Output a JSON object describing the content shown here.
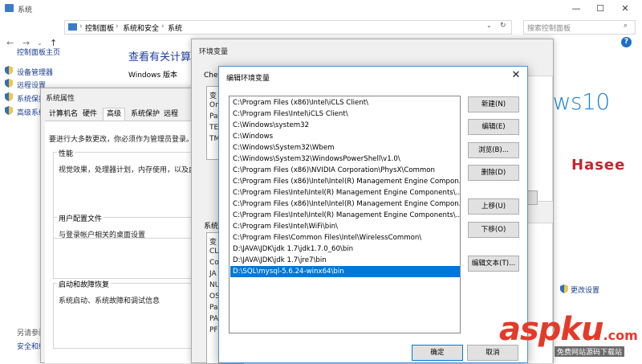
{
  "system_window": {
    "title": "系统",
    "breadcrumb": [
      "控制面板",
      "系统和安全",
      "系统"
    ],
    "search_placeholder": "搜索控制面板",
    "left_nav": {
      "home": "控制面板主页",
      "items": [
        "设备管理器",
        "远程设置",
        "系统保护",
        "高级系统"
      ],
      "see_also": "另请参阅",
      "security": "安全和维"
    },
    "heading": "查看有关计算机",
    "edition_label": "Windows 版本",
    "brand_text": "ows10",
    "logo_text": "Hasee",
    "change_settings": "更改设置",
    "help": "?"
  },
  "system_properties": {
    "title": "系统属性",
    "tabs": [
      "计算机名",
      "硬件",
      "高级",
      "系统保护",
      "远程"
    ],
    "active_tab": "高级",
    "admin_note": "要进行大多数更改，你必须作为管理员登录。",
    "groups": [
      {
        "title": "性能",
        "text": "视觉效果，处理器计划，内存使用，以及虚"
      },
      {
        "title": "用户配置文件",
        "text": "与登录帐户相关的桌面设置"
      },
      {
        "title": "启动和故障恢复",
        "text": "系统启动、系统故障和调试信息"
      }
    ]
  },
  "env_vars": {
    "title": "环境变量",
    "user_label": "Cher",
    "user_rows": [
      "变",
      "On",
      "Pa",
      "TE",
      "TM"
    ],
    "sys_label": "系统",
    "sys_rows": [
      "变",
      "CL",
      "Co",
      "JA",
      "NU",
      "OS",
      "Pa",
      "PA",
      "PF"
    ]
  },
  "edit_env": {
    "title": "编辑环境变量",
    "close": "✕",
    "paths": [
      "C:\\Program Files (x86)\\Intel\\iCLS Client\\",
      "C:\\Program Files\\Intel\\iCLS Client\\",
      "C:\\Windows\\system32",
      "C:\\Windows",
      "C:\\Windows\\System32\\Wbem",
      "C:\\Windows\\System32\\WindowsPowerShell\\v1.0\\",
      "C:\\Program Files (x86)\\NVIDIA Corporation\\PhysX\\Common",
      "C:\\Program Files (x86)\\Intel\\Intel(R) Management Engine Compon...",
      "C:\\Program Files\\Intel\\Intel(R) Management Engine Components\\...",
      "C:\\Program Files (x86)\\Intel\\Intel(R) Management Engine Compon...",
      "C:\\Program Files\\Intel\\Intel(R) Management Engine Components\\...",
      "C:\\Program Files\\Intel\\WiFi\\bin\\",
      "C:\\Program Files\\Common Files\\Intel\\WirelessCommon\\",
      "D:\\JAVA\\JDK\\jdk 1.7\\jdk1.7.0_60\\bin",
      "D:\\JAVA\\JDK\\jdk 1.7\\jre7\\bin",
      "D:\\SQL\\mysql-5.6.24-winx64\\bin"
    ],
    "selected_index": 15,
    "buttons": {
      "new": "新建(N)",
      "edit": "编辑(E)",
      "browse": "浏览(B)...",
      "delete": "删除(D)",
      "move_up": "上移(U)",
      "move_down": "下移(O)",
      "edit_text": "编辑文本(T)...",
      "ok": "确定",
      "cancel": "取消"
    }
  },
  "watermark": {
    "logo": "aspku",
    "dot_com": ".com",
    "tagline": "免费网站源码下载站"
  },
  "colors": {
    "accent": "#0078d7",
    "link": "#1a3d8f",
    "win10_blue": "#1c82d4",
    "watermark_red": "#e43a2a"
  }
}
